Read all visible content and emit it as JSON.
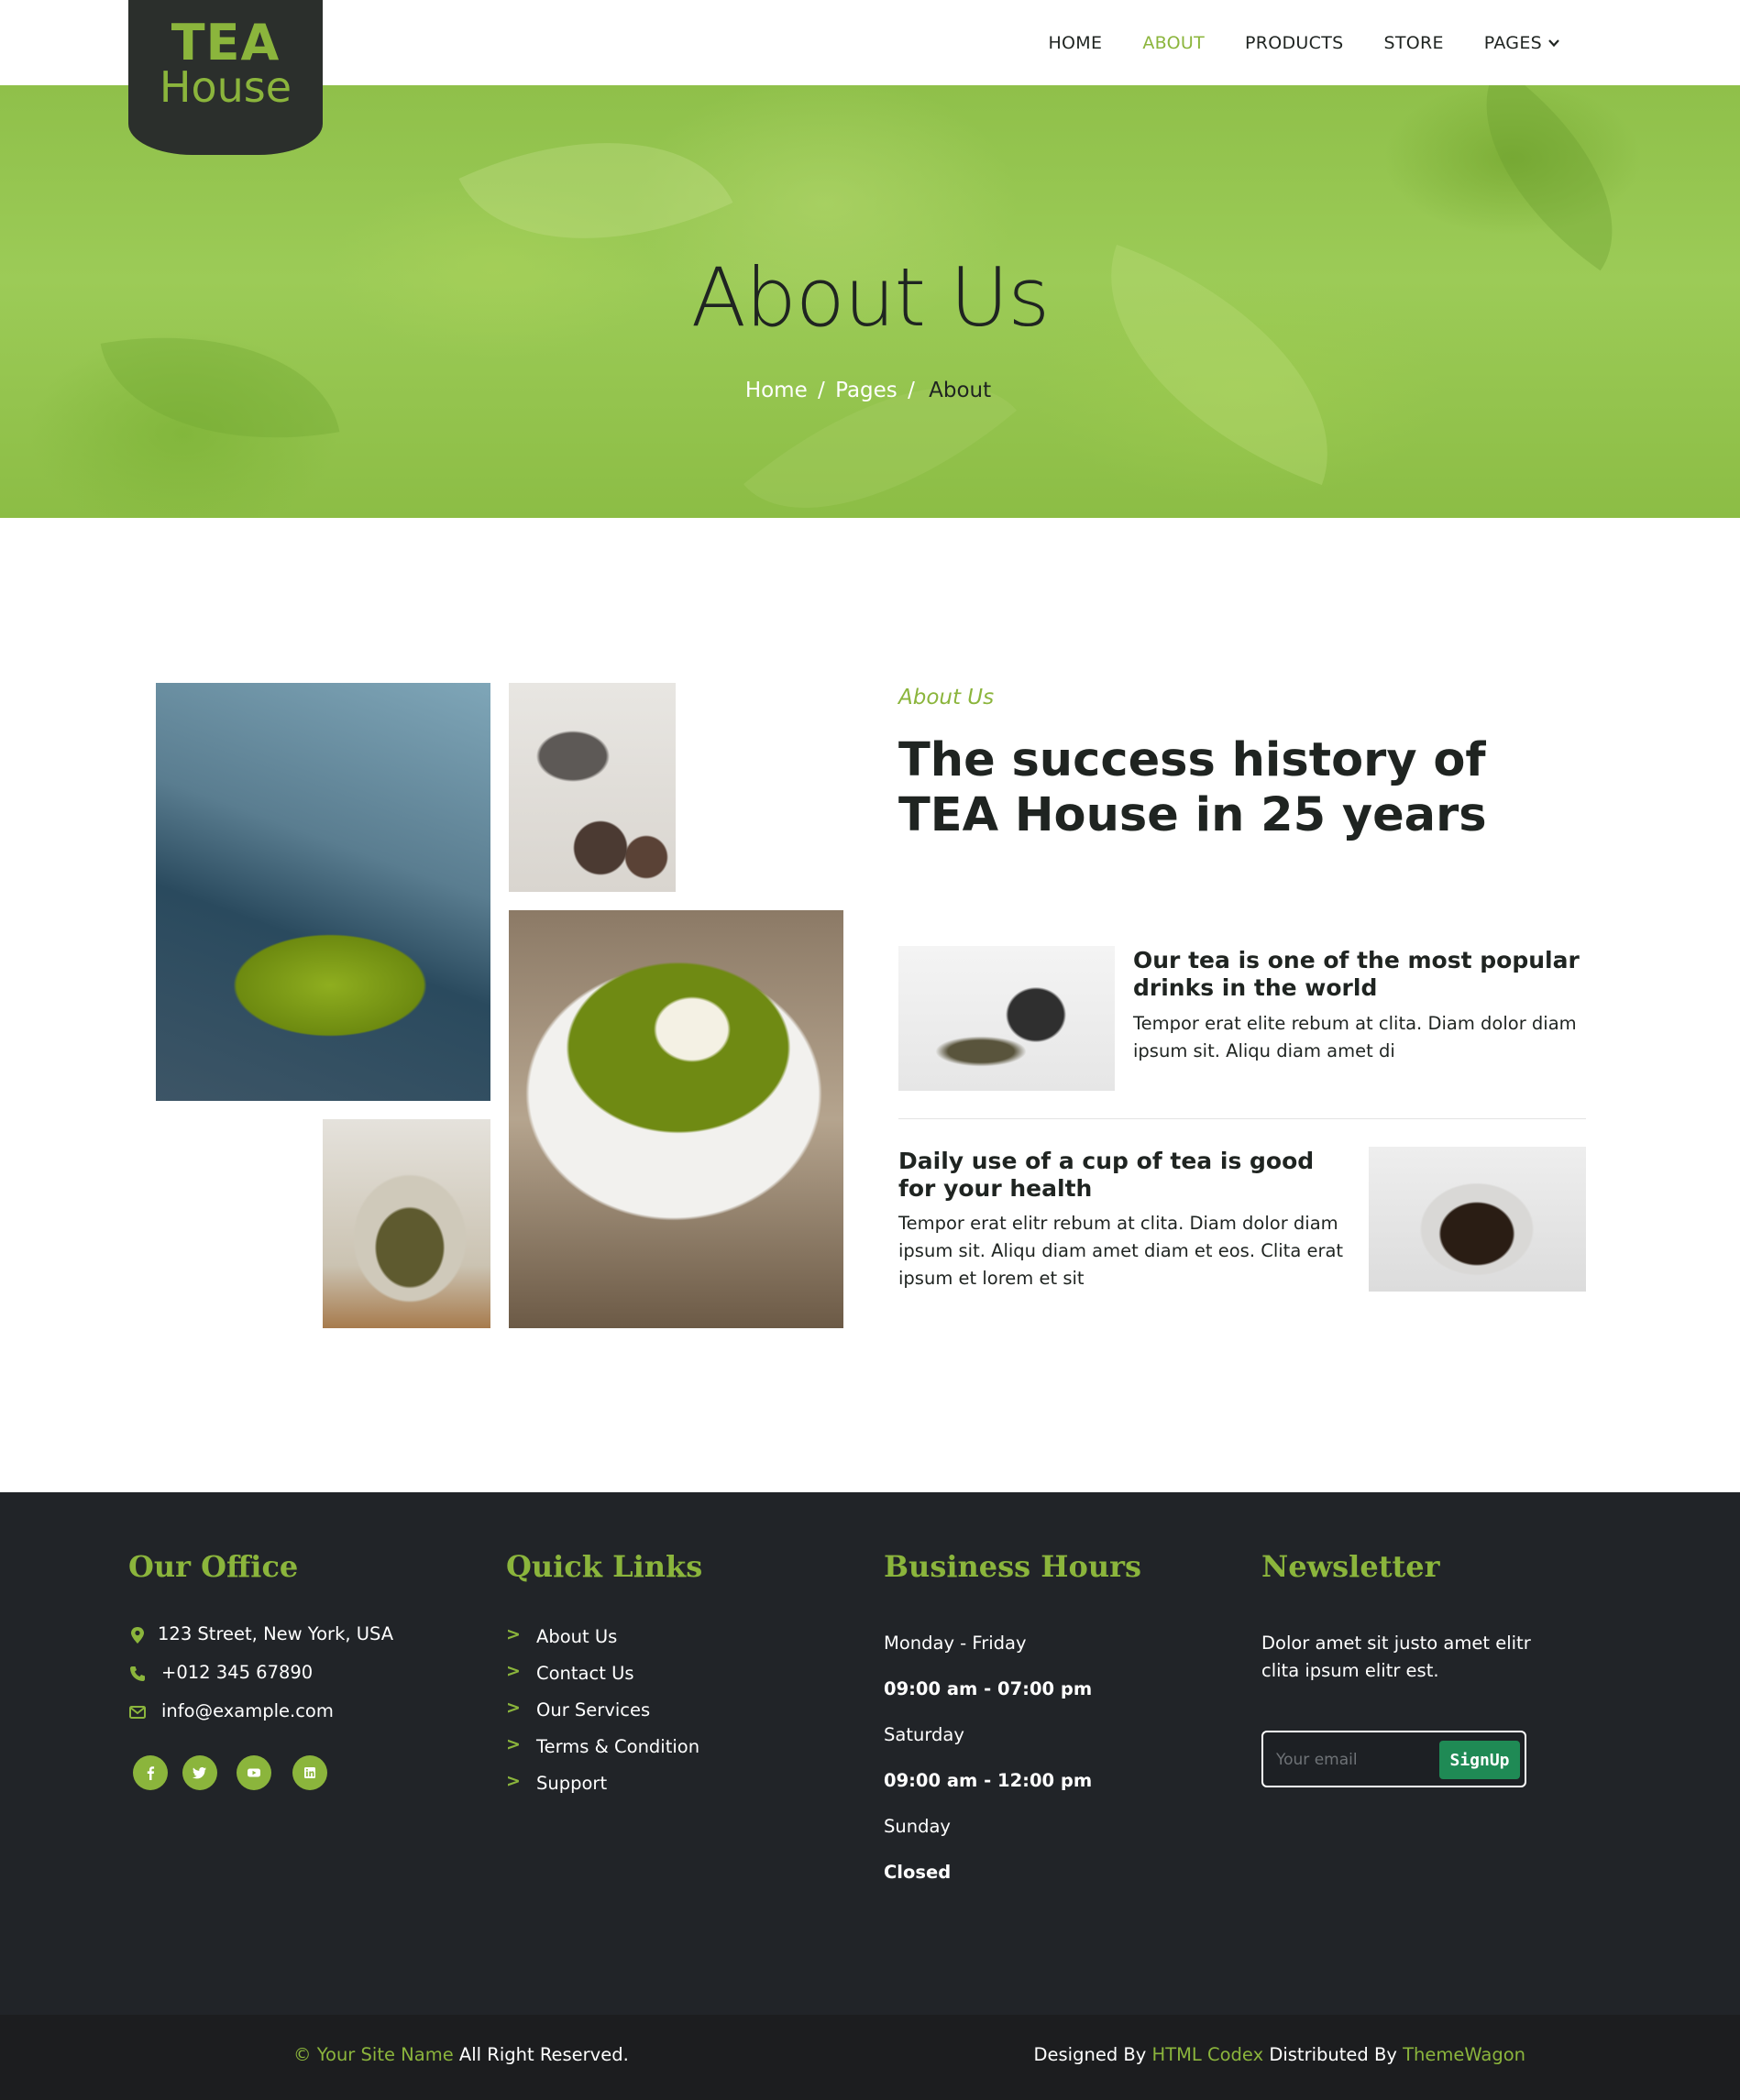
{
  "brand": {
    "logo_line1": "TEA",
    "logo_line2": "House",
    "accent_color": "#8bb53c",
    "dark_color": "#212428"
  },
  "nav": {
    "items": [
      {
        "label": "HOME"
      },
      {
        "label": "ABOUT",
        "active": true
      },
      {
        "label": "PRODUCTS"
      },
      {
        "label": "STORE"
      },
      {
        "label": "PAGES",
        "icon": "chevron-down-icon"
      }
    ]
  },
  "hero": {
    "title": "About Us",
    "breadcrumb": [
      "Home",
      "Pages",
      "About"
    ],
    "separator": "/"
  },
  "about": {
    "label": "About Us",
    "heading": "The success history of TEA House in 25 years",
    "features": [
      {
        "title": "Our tea is one of the most popular drinks in the world",
        "text": "Tempor erat elite rebum at clita. Diam dolor diam ipsum sit. Aliqu diam amet di"
      },
      {
        "title": "Daily use of a cup of tea is good for your health",
        "text": "Tempor erat elitr rebum at clita. Diam dolor diam ipsum sit. Aliqu diam amet diam et eos. Clita erat ipsum et lorem et sit"
      }
    ]
  },
  "footer": {
    "office": {
      "heading": "Our Office",
      "address": "123 Street, New York, USA",
      "phone": "+012 345 67890",
      "email": "info@example.com",
      "socials": [
        "facebook-icon",
        "twitter-icon",
        "youtube-icon",
        "linkedin-icon"
      ]
    },
    "quick_links": {
      "heading": "Quick Links",
      "arrow": ">",
      "links": [
        "About Us",
        "Contact Us",
        "Our Services",
        "Terms & Condition",
        "Support"
      ]
    },
    "hours": {
      "heading": "Business Hours",
      "rows": [
        {
          "day": "Monday - Friday",
          "time": "09:00 am - 07:00 pm"
        },
        {
          "day": "Saturday",
          "time": "09:00 am - 12:00 pm"
        },
        {
          "day": "Sunday",
          "time": "Closed"
        }
      ]
    },
    "newsletter": {
      "heading": "Newsletter",
      "text": "Dolor amet sit justo amet elitr clita ipsum elitr est.",
      "placeholder": "Your email",
      "button": "SignUp"
    }
  },
  "copyright": {
    "site_name": "© Your Site Name",
    "rights": "All Right Reserved.",
    "designed_by": "Designed By",
    "designer": "HTML Codex",
    "distributed_by": "Distributed By",
    "distributor": "ThemeWagon"
  }
}
